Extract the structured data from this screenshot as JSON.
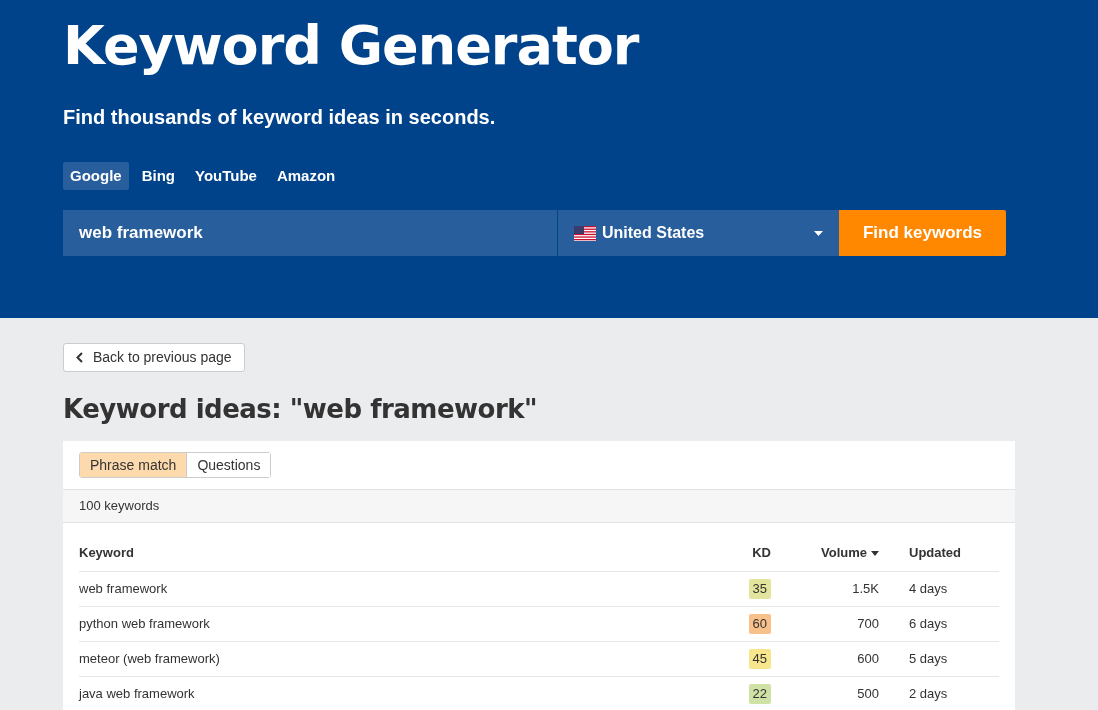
{
  "header": {
    "title": "Keyword Generator",
    "subtitle": "Find thousands of keyword ideas in seconds."
  },
  "engine_tabs": [
    {
      "label": "Google",
      "selected": true
    },
    {
      "label": "Bing",
      "selected": false
    },
    {
      "label": "YouTube",
      "selected": false
    },
    {
      "label": "Amazon",
      "selected": false
    }
  ],
  "search": {
    "value": "web framework",
    "country": "United States",
    "button": "Find keywords"
  },
  "back_button": "Back to previous page",
  "heading": "Keyword ideas: \"web framework\"",
  "match_tabs": [
    {
      "label": "Phrase match",
      "selected": true
    },
    {
      "label": "Questions",
      "selected": false
    }
  ],
  "count": "100 keywords",
  "table": {
    "columns": [
      "Keyword",
      "KD",
      "Volume",
      "Updated"
    ],
    "rows": [
      {
        "keyword": "web framework",
        "kd": "35",
        "color": "#e4e59c",
        "volume": "1.5K",
        "updated": "4 days"
      },
      {
        "keyword": "python web framework",
        "kd": "60",
        "color": "#f8c08a",
        "volume": "700",
        "updated": "6 days"
      },
      {
        "keyword": "meteor (web framework)",
        "kd": "45",
        "color": "#f8e68c",
        "volume": "600",
        "updated": "5 days"
      },
      {
        "keyword": "java web framework",
        "kd": "22",
        "color": "#cfe1a4",
        "volume": "500",
        "updated": "2 days"
      }
    ]
  }
}
